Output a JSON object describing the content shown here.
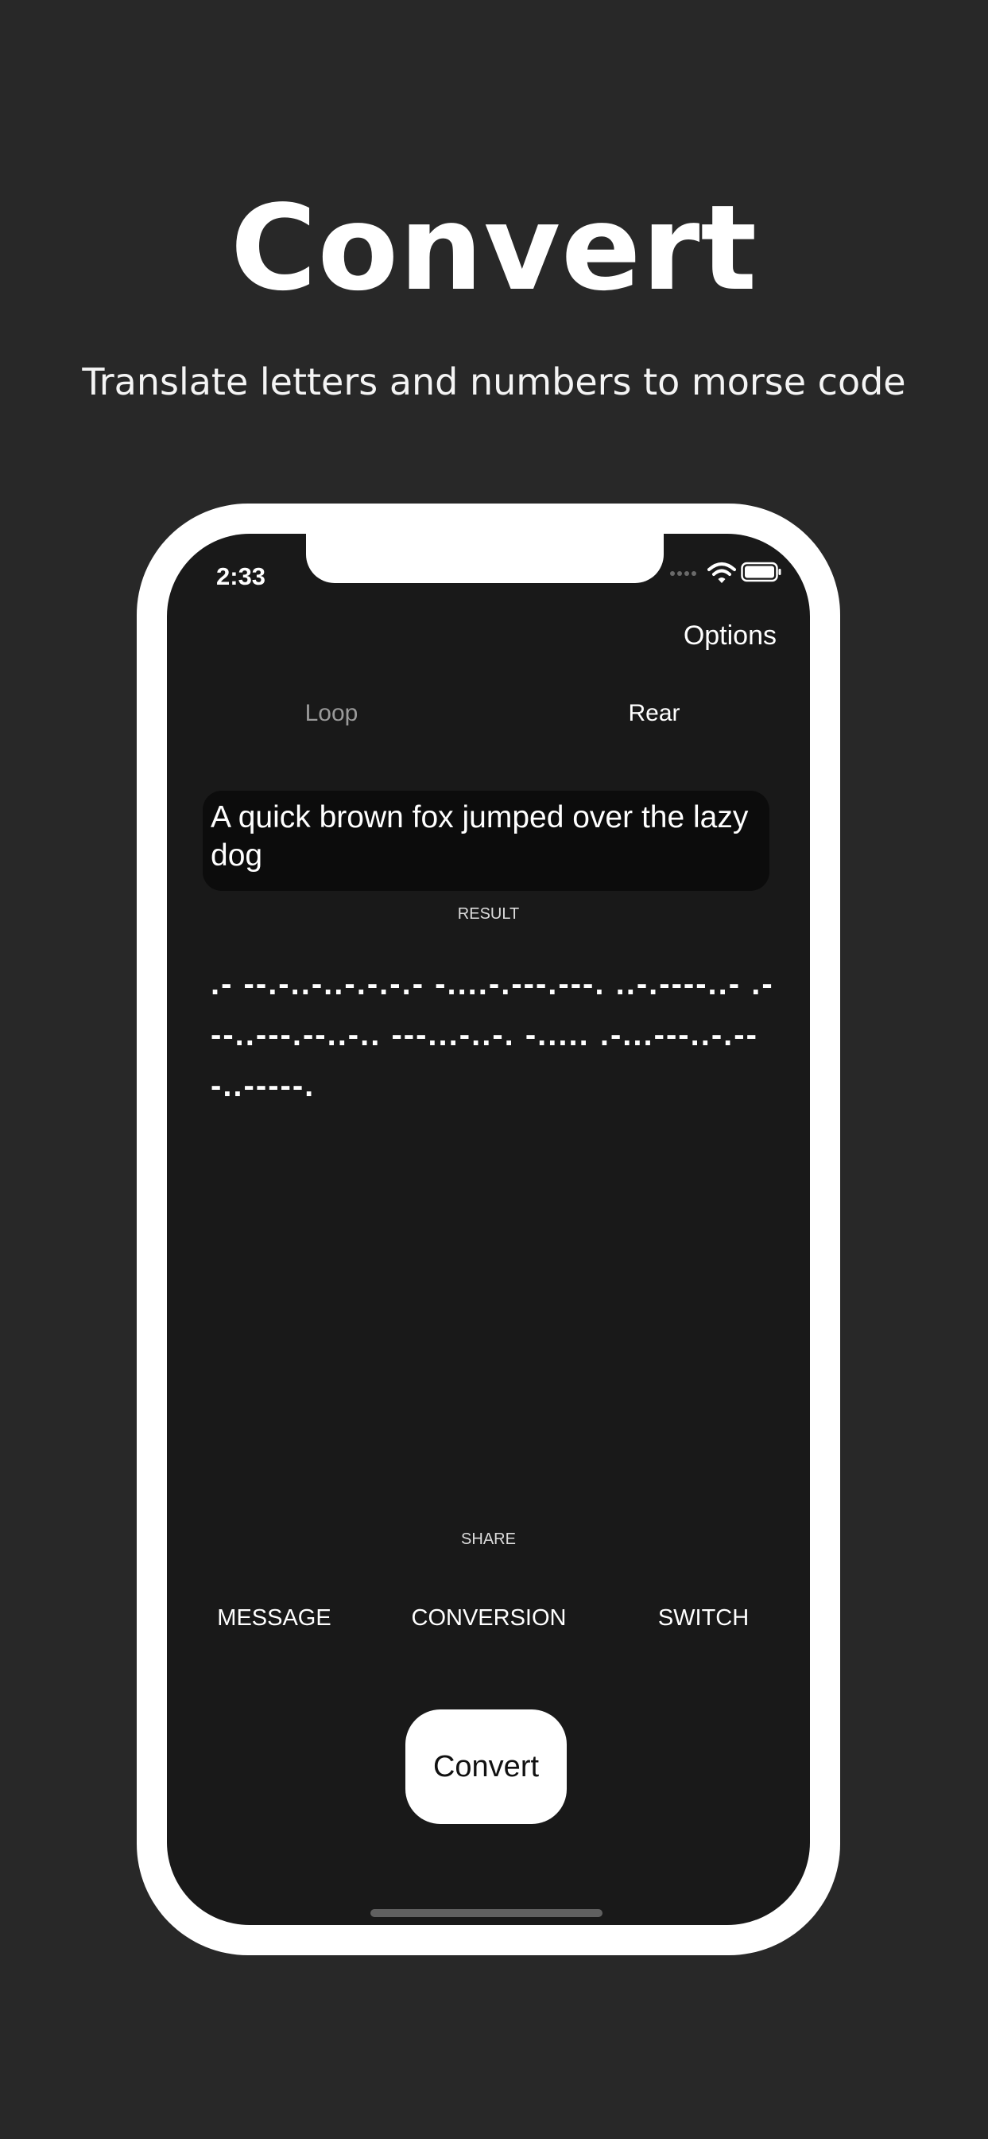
{
  "marketing": {
    "headline": "Convert",
    "subheadline": "Translate letters and numbers to morse code"
  },
  "status_bar": {
    "time": "2:33",
    "icons": [
      "signal-dots-icon",
      "wifi-icon",
      "battery-icon"
    ]
  },
  "nav": {
    "options_label": "Options"
  },
  "mode_toggle": {
    "loop_label": "Loop",
    "rear_label": "Rear",
    "selected": "Rear"
  },
  "input": {
    "value": "A quick brown fox jumped over the lazy dog"
  },
  "result": {
    "label": "RESULT",
    "morse_text": ".- --.-..-..-.-.-.- -....-.---.---. ..-.----..- .---..---.--..-.. ---...-..-. -..... .-...---..-.-- -..-----."
  },
  "share": {
    "label": "SHARE",
    "options": [
      "MESSAGE",
      "CONVERSION",
      "SWITCH"
    ]
  },
  "convert_button": {
    "label": "Convert"
  },
  "colors": {
    "page_background": "#282828",
    "screen_background": "#191919",
    "input_background": "#0c0c0c",
    "device_frame": "#ffffff",
    "text_primary": "#ffffff",
    "text_inactive": "#9a9a9a"
  }
}
